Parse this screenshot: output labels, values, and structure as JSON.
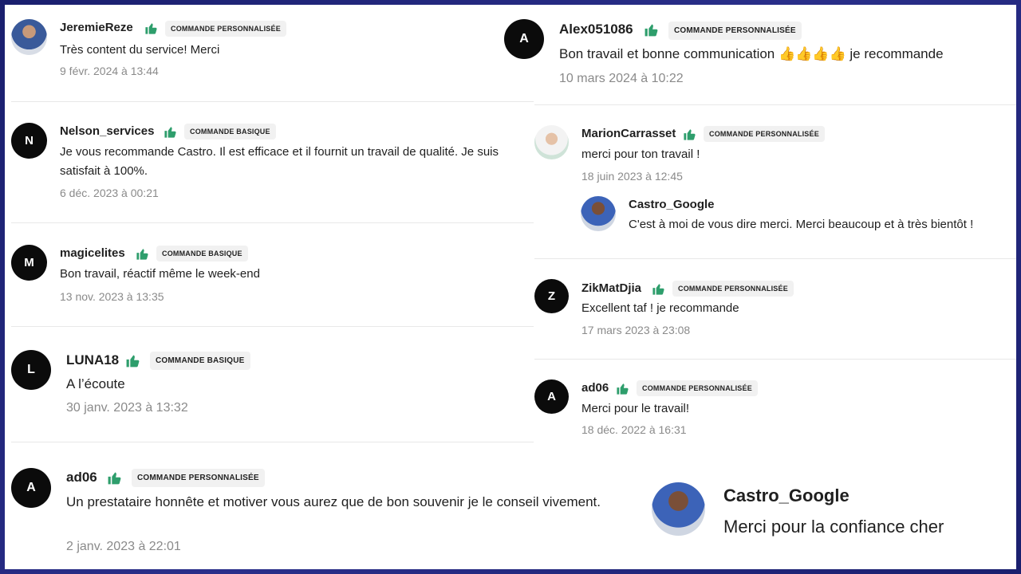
{
  "left_reviews": [
    {
      "avatar_letter": "",
      "name": "JeremieReze",
      "badge": "Commande personnalisée",
      "text": "Très content du service! Merci",
      "date": "9 févr. 2024 à 13:44"
    },
    {
      "avatar_letter": "N",
      "name": "Nelson_services",
      "badge": "Commande basique",
      "text": "Je vous recommande Castro. Il est efficace et il fournit un travail de qualité. Je suis satisfait à 100%.",
      "date": "6 déc. 2023 à 00:21"
    },
    {
      "avatar_letter": "M",
      "name": "magicelites",
      "badge": "Commande basique",
      "text": "Bon travail, réactif même le week-end",
      "date": "13 nov. 2023 à 13:35"
    },
    {
      "avatar_letter": "L",
      "name": "LUNA18",
      "badge": "Commande basique",
      "text": "A l’écoute",
      "date": "30 janv. 2023 à 13:32"
    },
    {
      "avatar_letter": "A",
      "name": "ad06",
      "badge": "Commande personnalisée",
      "text": "Un prestataire honnête et motiver vous aurez que de bon souvenir je le conseil vivement.",
      "date": "2 janv. 2023 à 22:01"
    }
  ],
  "right_reviews": [
    {
      "avatar_letter": "A",
      "name": "Alex051086",
      "badge": "Commande personnalisée",
      "text": "Bon travail et bonne communication 👍👍👍👍 je recommande",
      "date": "10 mars 2024 à 10:22"
    },
    {
      "avatar_letter": "",
      "name": "MarionCarrasset",
      "badge": "Commande personnalisée",
      "text": "merci pour ton travail !",
      "date": "18 juin 2023 à 12:45",
      "reply": {
        "name": "Castro_Google",
        "text": "C'est à moi de vous dire merci. Merci beaucoup et à très bientôt !"
      }
    },
    {
      "avatar_letter": "Z",
      "name": "ZikMatDjia",
      "badge": "Commande personnalisée",
      "text": "Excellent taf ! je recommande",
      "date": "17 mars 2023 à 23:08"
    },
    {
      "avatar_letter": "A",
      "name": "ad06",
      "badge": "Commande personnalisée",
      "text": "Merci pour le travail!",
      "date": "18 déc. 2022 à 16:31"
    }
  ],
  "bottom_reply": {
    "name": "Castro_Google",
    "text": "Merci pour la confiance cher"
  },
  "colors": {
    "thumb": "#2e9e6c",
    "avatar_bg": "#0b0b0b",
    "date": "#8a8a8a",
    "frame": "#1a1f6e"
  },
  "icons": {
    "thumb": "thumbs-up-icon"
  }
}
